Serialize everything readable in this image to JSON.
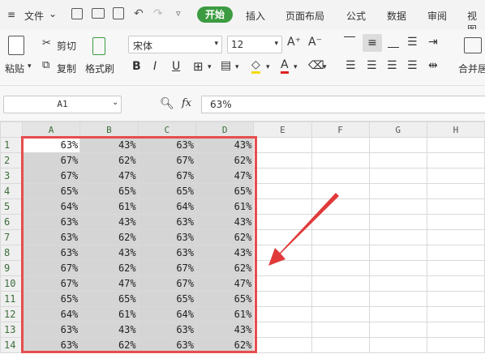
{
  "menubar": {
    "file_label": "文件",
    "tabs": [
      "开始",
      "插入",
      "页面布局",
      "公式",
      "数据",
      "审阅",
      "视图"
    ],
    "active_tab": 0,
    "active_color": "#3c9b41"
  },
  "ribbon": {
    "paste_label": "粘贴",
    "cut_label": "剪切",
    "copy_label": "复制",
    "format_painter_label": "格式刷",
    "font_name": "宋体",
    "font_size": "12",
    "merge_label": "合并居"
  },
  "formula_bar": {
    "name_box": "A1",
    "fx_label": "fx",
    "formula": "63%"
  },
  "sheet": {
    "columns": [
      "A",
      "B",
      "C",
      "D",
      "E",
      "F",
      "G",
      "H"
    ],
    "rows": [
      [
        "63%",
        "43%",
        "63%",
        "43%"
      ],
      [
        "67%",
        "62%",
        "67%",
        "62%"
      ],
      [
        "67%",
        "47%",
        "67%",
        "47%"
      ],
      [
        "65%",
        "65%",
        "65%",
        "65%"
      ],
      [
        "64%",
        "61%",
        "64%",
        "61%"
      ],
      [
        "63%",
        "43%",
        "63%",
        "43%"
      ],
      [
        "63%",
        "62%",
        "63%",
        "62%"
      ],
      [
        "63%",
        "43%",
        "63%",
        "43%"
      ],
      [
        "67%",
        "62%",
        "67%",
        "62%"
      ],
      [
        "67%",
        "47%",
        "67%",
        "47%"
      ],
      [
        "65%",
        "65%",
        "65%",
        "65%"
      ],
      [
        "64%",
        "61%",
        "64%",
        "61%"
      ],
      [
        "63%",
        "43%",
        "63%",
        "43%"
      ],
      [
        "63%",
        "62%",
        "63%",
        "62%"
      ]
    ],
    "selection_color": "#e64d4d",
    "arrow_color": "#e03a3a"
  }
}
